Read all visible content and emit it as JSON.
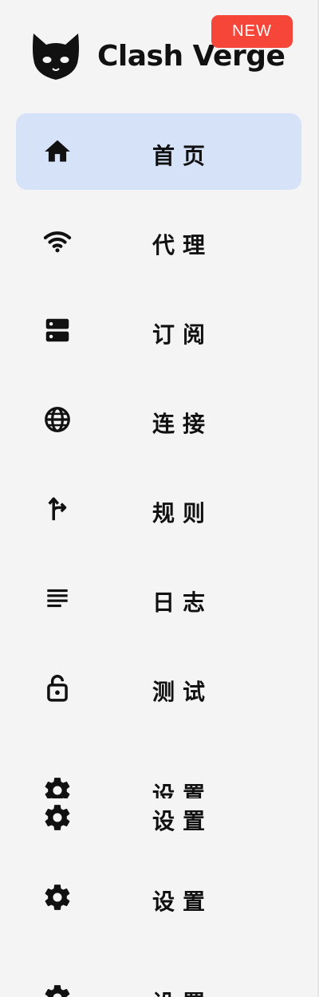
{
  "app": {
    "name": "Clash Verge",
    "badge": "NEW"
  },
  "nav": {
    "home": "首页",
    "proxies": "代理",
    "profiles": "订阅",
    "connections": "连接",
    "rules": "规则",
    "logs": "日志",
    "test": "测试",
    "settings": "设置"
  },
  "colors": {
    "active_bg": "#d6e2f8",
    "badge": "#f6463a",
    "sidebar_bg": "#f4f4f4"
  }
}
